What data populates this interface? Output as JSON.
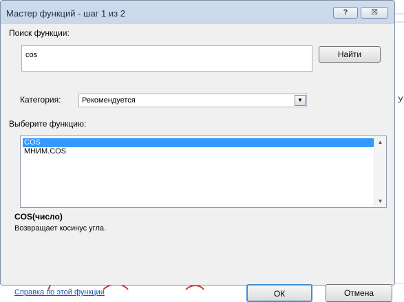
{
  "dialog": {
    "title": "Мастер функций - шаг 1 из 2",
    "help_button": "?",
    "close_button": "☒"
  },
  "search": {
    "label": "Поиск функции:",
    "value": "cos",
    "find_button": "Найти"
  },
  "category": {
    "label": "Категория:",
    "selected": "Рекомендуется",
    "dropdown_arrow": "▼"
  },
  "function_list": {
    "label": "Выберите функцию:",
    "items": [
      "COS",
      "МНИМ.COS"
    ],
    "selected_index": 0,
    "scroll_up": "▲",
    "scroll_down": "▼"
  },
  "description": {
    "signature": "COS(число)",
    "text": "Возвращает косинус угла."
  },
  "footer": {
    "help_link": "Справка по этой функции",
    "ok_button": "ОК",
    "cancel_button": "Отмена"
  },
  "background": {
    "cell_letter": "У"
  },
  "colors": {
    "selection": "#3399ff",
    "link": "#1a4fb3",
    "title_gradient": "#c9d7ea"
  }
}
